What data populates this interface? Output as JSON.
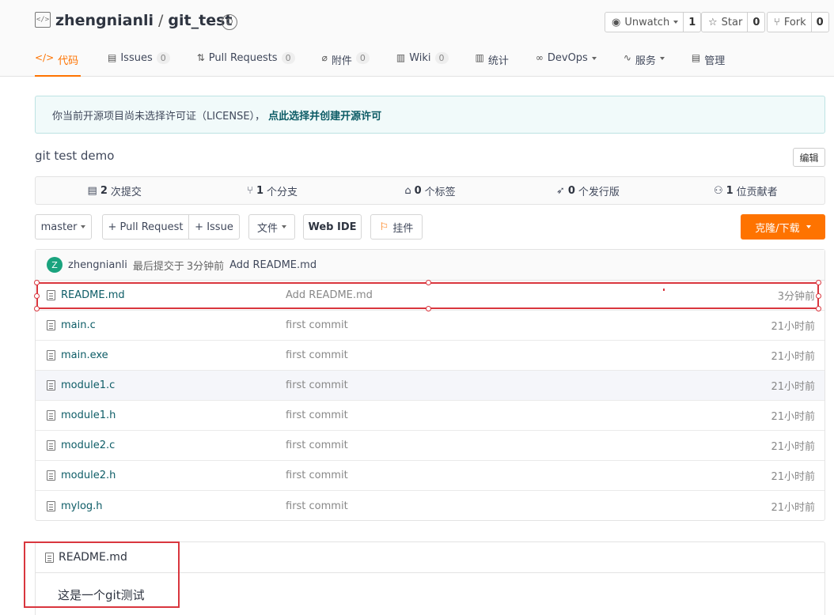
{
  "repo": {
    "owner": "zhengnianli",
    "separator": "/",
    "name": "git_test",
    "code_icon": "</>"
  },
  "actions": {
    "watch_label": "Unwatch",
    "watch_count": "1",
    "star_label": "Star",
    "star_count": "0",
    "fork_label": "Fork",
    "fork_count": "0"
  },
  "tabs": [
    {
      "label": "代码",
      "icon": "</>",
      "count": null
    },
    {
      "label": "Issues",
      "icon": "▤",
      "count": "0"
    },
    {
      "label": "Pull Requests",
      "icon": "⇅",
      "count": "0"
    },
    {
      "label": "附件",
      "icon": "⌀",
      "count": "0"
    },
    {
      "label": "Wiki",
      "icon": "▥",
      "count": "0"
    },
    {
      "label": "统计",
      "icon": "▥",
      "count": null
    },
    {
      "label": "DevOps",
      "icon": "∞",
      "count": null
    },
    {
      "label": "服务",
      "icon": "∿",
      "count": null
    },
    {
      "label": "管理",
      "icon": "▤",
      "count": null
    }
  ],
  "license": {
    "text": "你当前开源项目尚未选择许可证（LICENSE），",
    "link": "点此选择并创建开源许可"
  },
  "description": "git test demo",
  "edit_label": "编辑",
  "stats": [
    {
      "icon": "▤",
      "count": "2",
      "label": "次提交"
    },
    {
      "icon": "⑂",
      "count": "1",
      "label": "个分支"
    },
    {
      "icon": "⌂",
      "count": "0",
      "label": "个标签"
    },
    {
      "icon": "➶",
      "count": "0",
      "label": "个发行版"
    },
    {
      "icon": "⚇",
      "count": "1",
      "label": "位贡献者"
    }
  ],
  "toolbar": {
    "branch": "master",
    "pull_request": "+ Pull Request",
    "issue": "+ Issue",
    "files": "文件",
    "web_ide": "Web IDE",
    "widget": "挂件",
    "clone": "克隆/下载"
  },
  "last_commit": {
    "avatar_letter": "Z",
    "author": "zhengnianli",
    "meta": "最后提交于",
    "time": "3分钟前",
    "message": "Add README.md"
  },
  "files": [
    {
      "name": "README.md",
      "message": "Add README.md",
      "time": "3分钟前"
    },
    {
      "name": "main.c",
      "message": "first commit",
      "time": "21小时前"
    },
    {
      "name": "main.exe",
      "message": "first commit",
      "time": "21小时前"
    },
    {
      "name": "module1.c",
      "message": "first commit",
      "time": "21小时前"
    },
    {
      "name": "module1.h",
      "message": "first commit",
      "time": "21小时前"
    },
    {
      "name": "module2.c",
      "message": "first commit",
      "time": "21小时前"
    },
    {
      "name": "module2.h",
      "message": "first commit",
      "time": "21小时前"
    },
    {
      "name": "mylog.h",
      "message": "first commit",
      "time": "21小时前"
    }
  ],
  "readme": {
    "title": "README.md",
    "content": "这是一个git测试"
  },
  "colors": {
    "accent": "#fe7300",
    "link": "#0d5c66",
    "annotation": "#d9363e"
  }
}
